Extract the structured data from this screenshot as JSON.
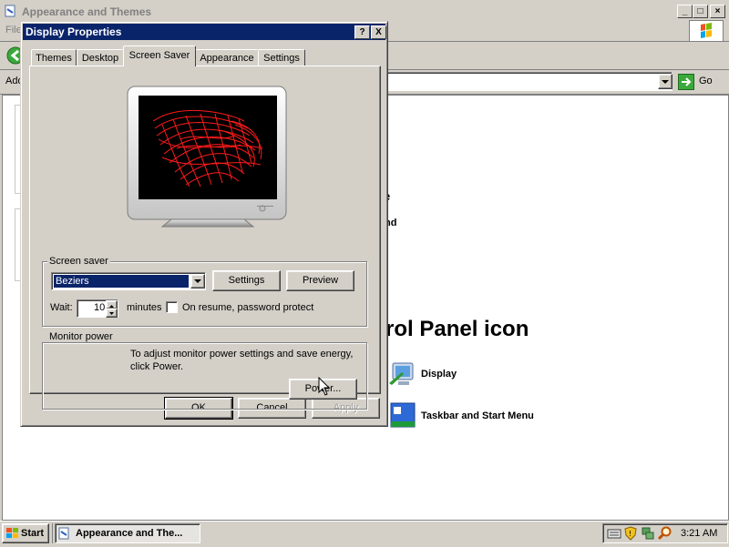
{
  "bg_window": {
    "title": "Appearance and Themes",
    "menu_file": "File",
    "address_label": "Address",
    "go_label": "Go",
    "partial_text_1": "e",
    "partial_text_2": "nd",
    "heading_partial": "rol Panel icon",
    "links": [
      {
        "label": "Display",
        "icon": "display-icon"
      },
      {
        "label": "Taskbar and Start Menu",
        "icon": "taskbar-icon"
      }
    ]
  },
  "dialog": {
    "title": "Display Properties",
    "help_label": "?",
    "close_label": "X",
    "tabs": [
      "Themes",
      "Desktop",
      "Screen Saver",
      "Appearance",
      "Settings"
    ],
    "active_tab": "Screen Saver",
    "screensaver": {
      "group_label": "Screen saver",
      "selected": "Beziers",
      "settings_button": "Settings",
      "preview_button": "Preview",
      "wait_label": "Wait:",
      "wait_value": "10",
      "minutes_label": "minutes",
      "password_checkbox_label": "On resume, password protect"
    },
    "monitor_power": {
      "group_label": "Monitor power",
      "description": "To adjust monitor power settings and save energy, click Power.",
      "power_button": "Power..."
    },
    "buttons": {
      "ok": "OK",
      "cancel": "Cancel",
      "apply": "Apply"
    }
  },
  "taskbar": {
    "start_label": "Start",
    "task_label": "Appearance and The...",
    "clock": "3:21 AM"
  },
  "colors": {
    "titlebar_active": "#0a246a",
    "face": "#d4d0c8",
    "preview_line": "#ff1a1a",
    "select_highlight": "#0a246a"
  }
}
